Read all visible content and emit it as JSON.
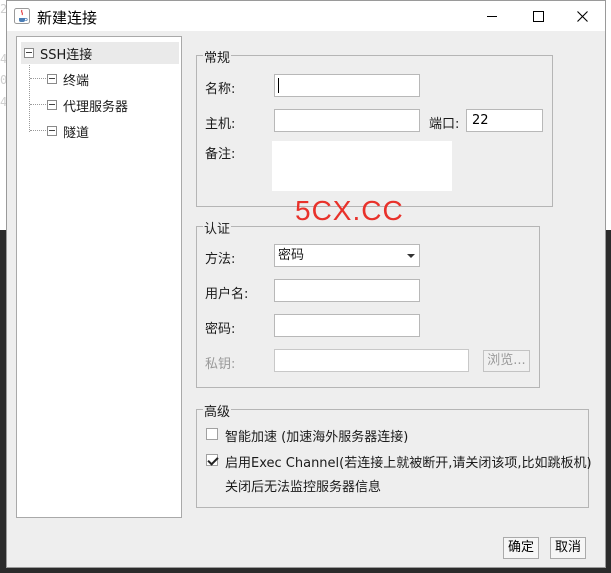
{
  "window": {
    "title": "新建连接"
  },
  "background": {
    "fragments": [
      "2",
      "4",
      "0",
      "4"
    ]
  },
  "tree": {
    "root": "SSH连接",
    "children": [
      "终端",
      "代理服务器",
      "隧道"
    ]
  },
  "general": {
    "title": "常规",
    "name_label": "名称:",
    "name_value": "",
    "host_label": "主机:",
    "host_value": "",
    "port_label": "端口:",
    "port_value": "22",
    "note_label": "备注:",
    "note_value": ""
  },
  "auth": {
    "title": "认证",
    "method_label": "方法:",
    "method_value": "密码",
    "username_label": "用户名:",
    "username_value": "",
    "password_label": "密码:",
    "password_value": "",
    "key_label": "私钥:",
    "key_value": "",
    "browse_label": "浏览..."
  },
  "advanced": {
    "title": "高级",
    "smart_accel_label": "智能加速 (加速海外服务器连接)",
    "smart_accel_checked": false,
    "exec_channel_label": "启用Exec Channel(若连接上就被断开,请关闭该项,比如跳板机)",
    "exec_channel_checked": true,
    "exec_channel_note": "关闭后无法监控服务器信息"
  },
  "buttons": {
    "ok": "确定",
    "cancel": "取消"
  },
  "watermark": "5CX.CC",
  "colors": {
    "watermark": "#e8322b",
    "dialog_bg": "#eeeeee"
  }
}
